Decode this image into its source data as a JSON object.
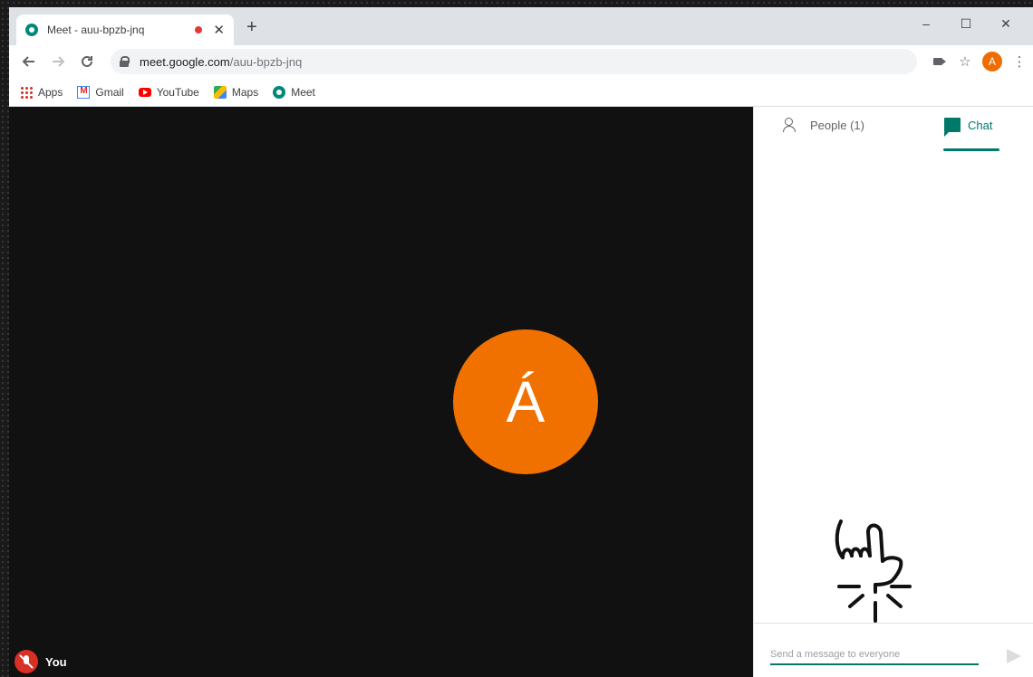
{
  "browser": {
    "tab": {
      "title": "Meet - auu-bpzb-jnq",
      "close": "✕"
    },
    "new_tab": "+",
    "window_controls": {
      "minimize": "–",
      "maximize": "☐",
      "close": "✕"
    },
    "address": {
      "host": "meet.google.com",
      "path": "/auu-bpzb-jnq"
    },
    "profile_initial": "A"
  },
  "bookmarks": [
    {
      "label": "Apps",
      "icon": "apps-grid-icon"
    },
    {
      "label": "Gmail",
      "icon": "gmail-icon"
    },
    {
      "label": "YouTube",
      "icon": "youtube-icon"
    },
    {
      "label": "Maps",
      "icon": "maps-icon"
    },
    {
      "label": "Meet",
      "icon": "meet-icon"
    }
  ],
  "meeting": {
    "avatar_initial": "Á",
    "self_label": "You"
  },
  "panel": {
    "people_tab": "People (1)",
    "chat_tab": "Chat",
    "compose_placeholder": "Send a message to everyone"
  },
  "colors": {
    "accent": "#00796b",
    "avatar": "#f07100",
    "stage": "#111111"
  }
}
